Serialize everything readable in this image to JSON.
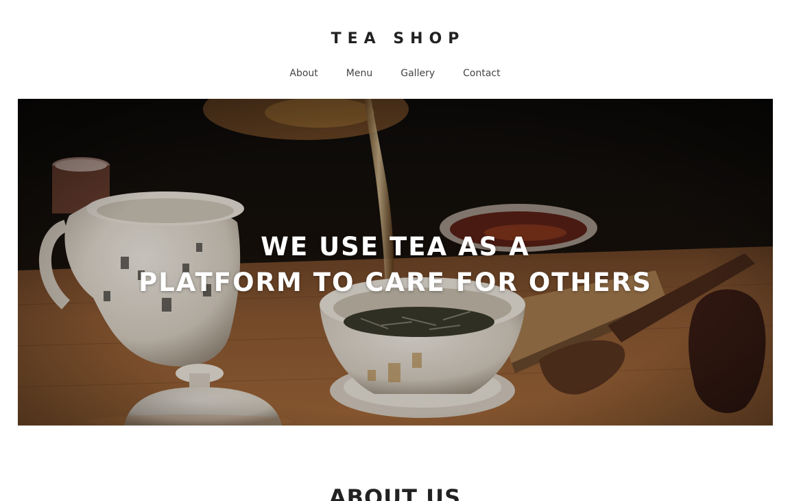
{
  "header": {
    "brand": "TEA SHOP",
    "nav": [
      {
        "label": "About"
      },
      {
        "label": "Menu"
      },
      {
        "label": "Gallery"
      },
      {
        "label": "Contact"
      }
    ]
  },
  "hero": {
    "headline_line1": "WE USE TEA AS A",
    "headline_line2": "PLATFORM TO CARE FOR OTHERS",
    "image_icon": "tea-ceremony-photo"
  },
  "sections": {
    "about_title": "ABOUT US"
  },
  "colors": {
    "text": "#222222",
    "nav_text": "#444444",
    "hero_overlay_text": "#ffffff",
    "hero_wood": "#8a5a34",
    "hero_dark": "#120d0a"
  }
}
